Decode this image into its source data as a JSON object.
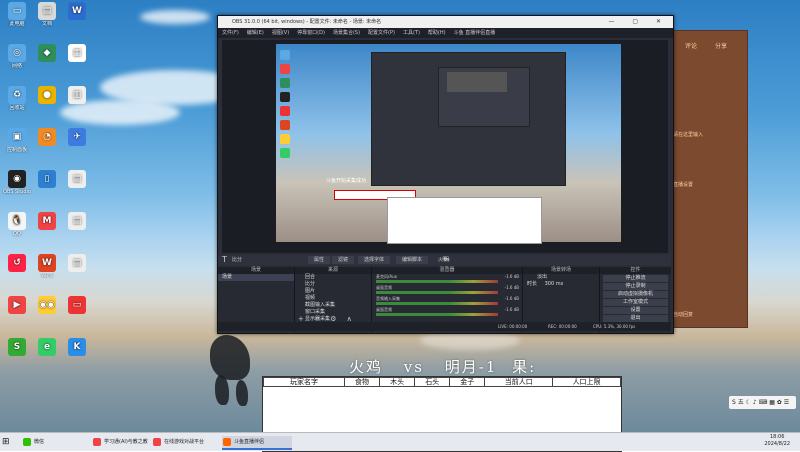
{
  "desktop": {
    "icons": [
      {
        "label": "此电脑",
        "color": "#5aa9e6",
        "glyph": "▭"
      },
      {
        "label": "文档",
        "color": "#d9d9d9",
        "glyph": "▤"
      },
      {
        "label": "",
        "color": "#2b6cd1",
        "glyph": "W"
      },
      {
        "label": "网络",
        "color": "#5aa9e6",
        "glyph": "◎"
      },
      {
        "label": "",
        "color": "#2f8f5b",
        "glyph": "◆"
      },
      {
        "label": "",
        "color": "#fff",
        "glyph": "▦"
      },
      {
        "label": "回收站",
        "color": "#5aa9e6",
        "glyph": "♻"
      },
      {
        "label": "",
        "color": "#e8b400",
        "glyph": "●"
      },
      {
        "label": "",
        "color": "#eee",
        "glyph": "▥"
      },
      {
        "label": "控制面板",
        "color": "#5aa9e6",
        "glyph": "▣"
      },
      {
        "label": "",
        "color": "#f08a24",
        "glyph": "◔"
      },
      {
        "label": "",
        "color": "#3d7be0",
        "glyph": "✈"
      },
      {
        "label": "OBS Studio",
        "color": "#222",
        "glyph": "◉"
      },
      {
        "label": "",
        "color": "#2c7fd1",
        "glyph": "▯"
      },
      {
        "label": "",
        "color": "#eee",
        "glyph": "▤"
      },
      {
        "label": "QQ",
        "color": "#f5f5f5",
        "glyph": "🐧"
      },
      {
        "label": "",
        "color": "#e44",
        "glyph": "M"
      },
      {
        "label": "",
        "color": "#eee",
        "glyph": "▤"
      },
      {
        "label": "",
        "color": "#f24",
        "glyph": "↺"
      },
      {
        "label": "WPS",
        "color": "#d42",
        "glyph": "W"
      },
      {
        "label": "",
        "color": "#eee",
        "glyph": "▤"
      },
      {
        "label": "",
        "color": "#e44",
        "glyph": "▶"
      },
      {
        "label": "",
        "color": "#fc3",
        "glyph": "◉◉"
      },
      {
        "label": "",
        "color": "#e33",
        "glyph": "▭"
      },
      {
        "label": "",
        "color": "#3a3",
        "glyph": "S"
      },
      {
        "label": "",
        "color": "#3c6",
        "glyph": "e"
      },
      {
        "label": "",
        "color": "#2a8de6",
        "glyph": "K"
      }
    ]
  },
  "obs": {
    "title": "OBS 31.0.0 (64 bit, windows) - 配置文件: 未命名 - 场景: 未命名",
    "menu": [
      "文件(F)",
      "编辑(E)",
      "视图(V)",
      "停靠窗口(D)",
      "场景集合(S)",
      "配置文件(P)",
      "工具(T)",
      "帮助(H)",
      "斗鱼 直播伴侣直播"
    ],
    "preview_caption": "斗鱼开始采集成功",
    "toolbar": {
      "source_name": "比分",
      "btn_props": "属性",
      "btn_filters": "滤镜",
      "btn_select": "选择字体",
      "btn_edit": "编辑脚本",
      "game_text": "火鸡",
      "vs": "vs",
      "opponent": "明月-1",
      "suffix": "果:"
    },
    "docks": {
      "scenes": {
        "header": "场景",
        "items": [
          "场景"
        ]
      },
      "sources": {
        "header": "来源",
        "items": [
          "回合",
          "比分",
          "图片",
          "视频",
          "截图输入采集",
          "窗口采集",
          "显示器采集"
        ]
      },
      "mixer": {
        "header": "混音器",
        "channels": [
          {
            "name": "麦克风/Aux",
            "db": "-1.6 dB"
          },
          {
            "name": "桌面音频",
            "db": "-1.6 dB"
          },
          {
            "name": "音频输入采集",
            "db": "-1.6 dB"
          },
          {
            "name": "桌面音频",
            "db": "-1.6 dB"
          }
        ]
      },
      "transitions": {
        "header": "场景转场",
        "type": "淡出",
        "duration_label": "时长",
        "duration": "300 ms"
      },
      "controls": {
        "header": "控件",
        "buttons": [
          "停止推流",
          "停止录制",
          "启动虚拟摄像机",
          "工作室模式",
          "设置",
          "退出"
        ]
      }
    },
    "status": {
      "live": "LIVE: 00:00:00",
      "rec": "REC: 00:00:00",
      "cpu": "CPU: 5.3%, 30.00 fps"
    }
  },
  "orange_panel": {
    "lines": [
      "评论",
      "分享",
      "请在这里输入",
      "直播设置",
      "自动回复"
    ]
  },
  "game": {
    "title_left": "火鸡",
    "vs": "vs",
    "title_right": "明月-1",
    "title_suffix": "果:",
    "columns": [
      "玩家名字",
      "食物",
      "木头",
      "石头",
      "金子",
      "当前人口",
      "人口上限"
    ]
  },
  "ime": {
    "text": "S 五 ☾ ♪ ⌨ ▦ ✿ ☰"
  },
  "taskbar": {
    "items": [
      {
        "label": "微信",
        "color": "#2dc100"
      },
      {
        "label": "学习通(AI)与教之教",
        "color": "#e44"
      },
      {
        "label": "在线游戏对战平台",
        "color": "#e44"
      },
      {
        "label": "斗鱼直播伴侣",
        "color": "#f60"
      }
    ],
    "time": "18:06",
    "date": "2024/8/22"
  }
}
